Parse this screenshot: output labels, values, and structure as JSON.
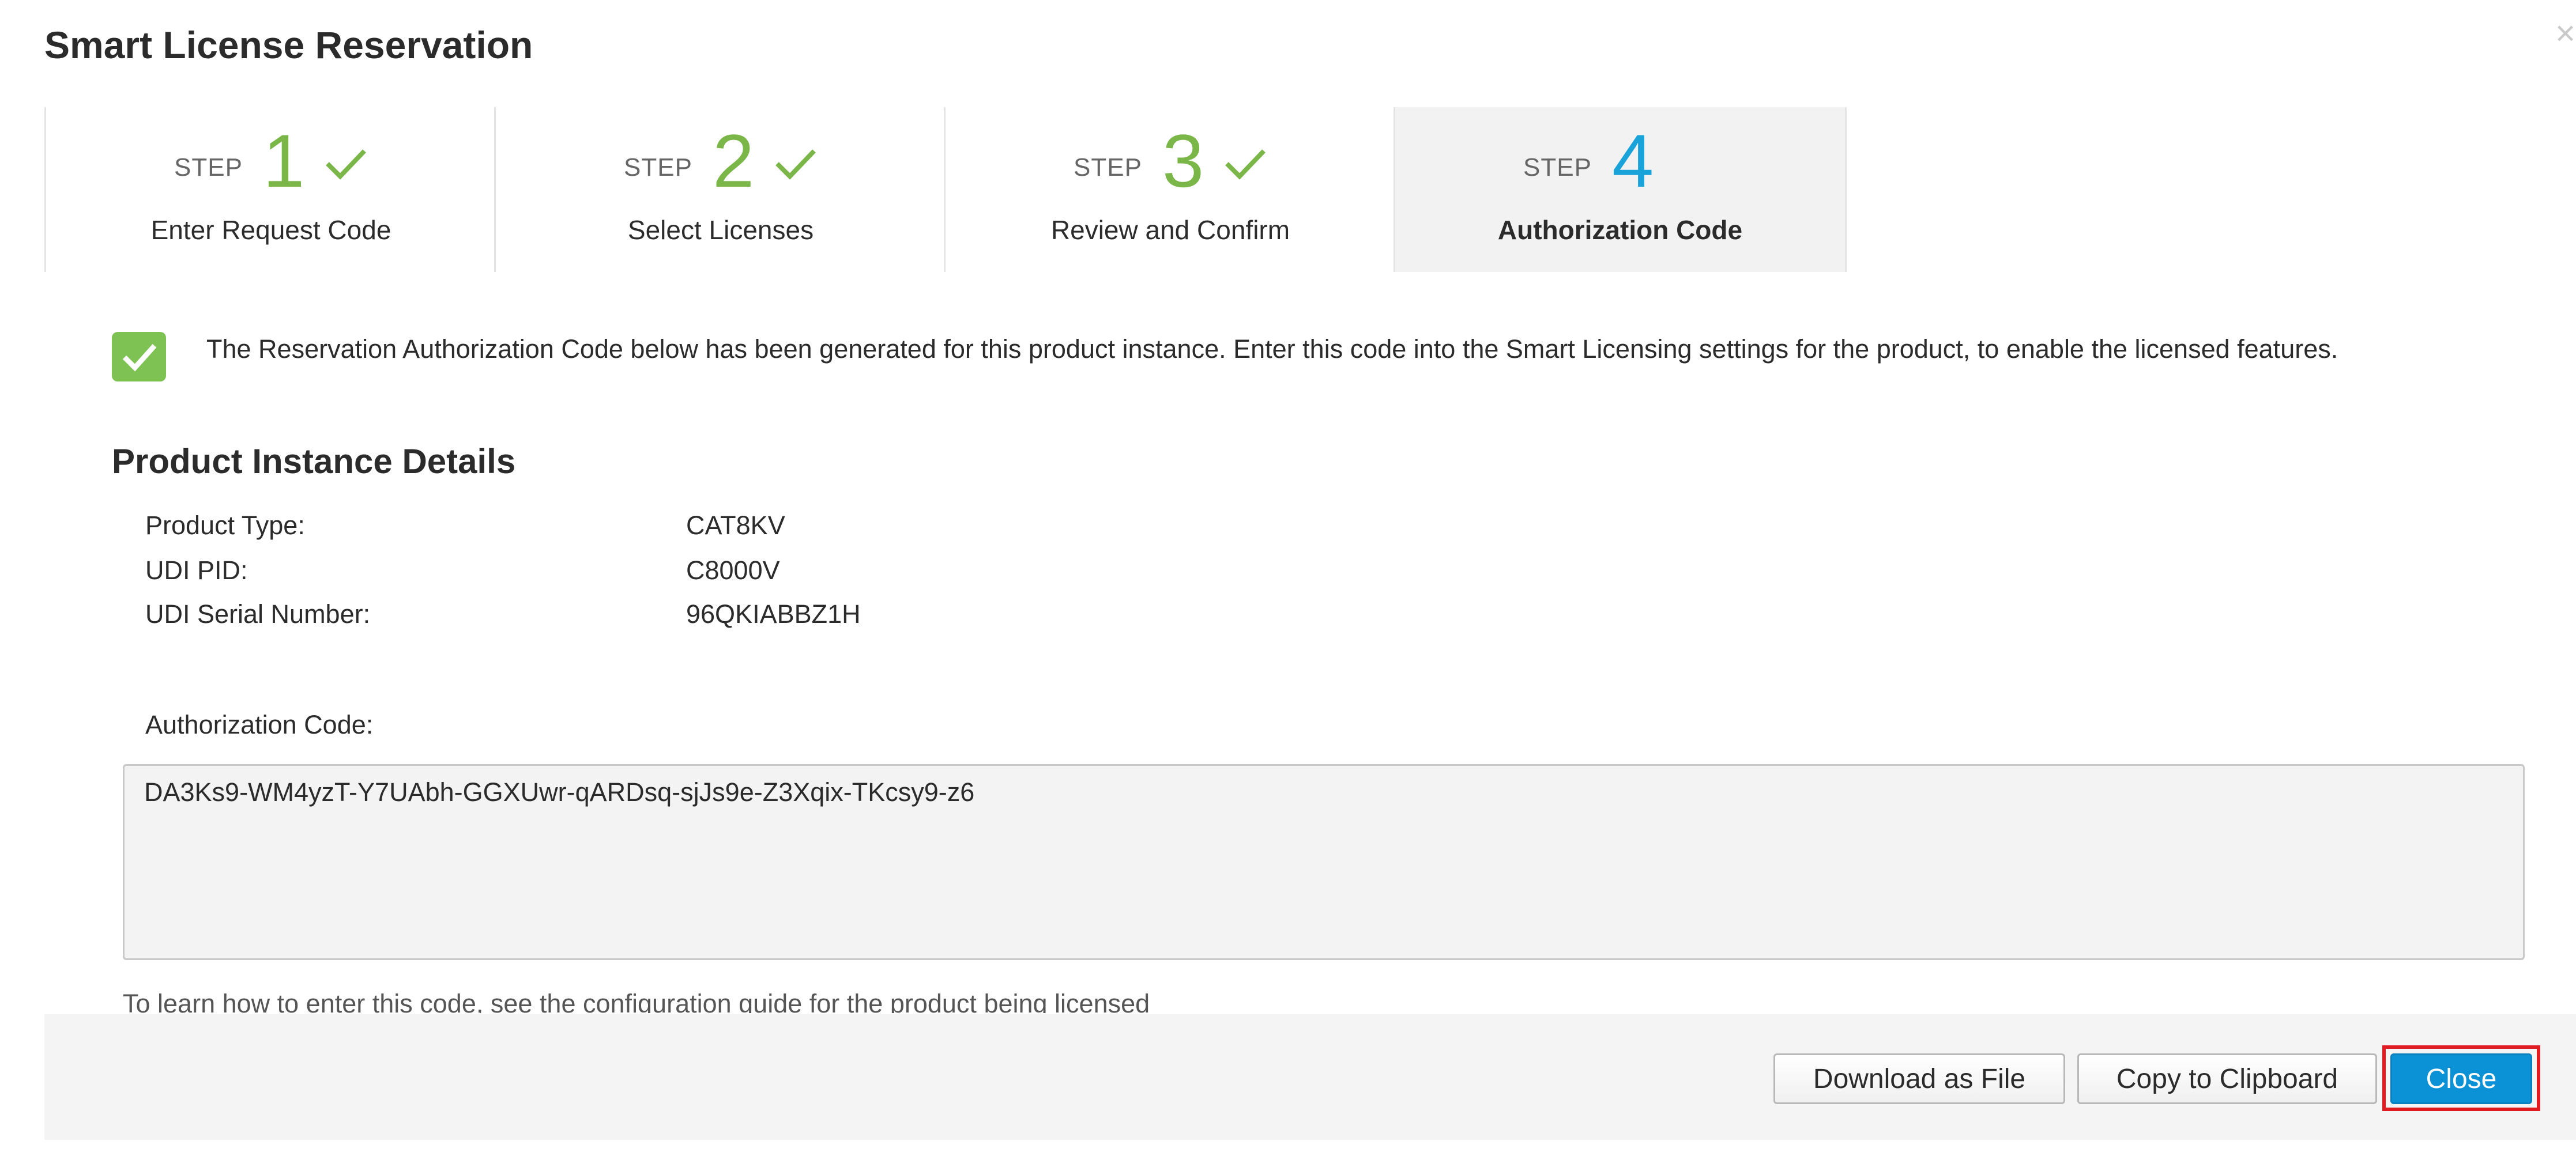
{
  "dialog": {
    "title": "Smart License Reservation",
    "close_symbol": "×"
  },
  "steps": [
    {
      "word": "STEP",
      "number": "1",
      "label": "Enter Request Code",
      "status": "completed",
      "icon": "check-icon"
    },
    {
      "word": "STEP",
      "number": "2",
      "label": "Select Licenses",
      "status": "completed",
      "icon": "check-icon"
    },
    {
      "word": "STEP",
      "number": "3",
      "label": "Review and Confirm",
      "status": "completed",
      "icon": "check-icon"
    },
    {
      "word": "STEP",
      "number": "4",
      "label": "Authorization Code",
      "status": "current",
      "icon": ""
    }
  ],
  "message": {
    "icon": "checkbox-check-icon",
    "text": "The Reservation Authorization Code below has been generated for this product instance. Enter this code into the Smart Licensing settings for the product, to enable the licensed features."
  },
  "details": {
    "title": "Product Instance Details",
    "rows": [
      {
        "label": "Product Type:",
        "value": "CAT8KV"
      },
      {
        "label": "UDI PID:",
        "value": "C8000V"
      },
      {
        "label": "UDI Serial Number:",
        "value": "96QKIABBZ1H"
      }
    ]
  },
  "authorization": {
    "label": "Authorization Code:",
    "code": "DA3Ks9-WM4yzT-Y7UAbh-GGXUwr-qARDsq-sjJs9e-Z3Xqix-TKcsy9-z6",
    "help_text": "To learn how to enter this code, see the configuration guide for the product being licensed"
  },
  "footer": {
    "download_label": "Download as File",
    "copy_label": "Copy to Clipboard",
    "close_label": "Close"
  },
  "colors": {
    "completed": "#7ab648",
    "current": "#1aa3d9",
    "primary_button": "#0a91d6",
    "highlight": "#e01b22"
  }
}
